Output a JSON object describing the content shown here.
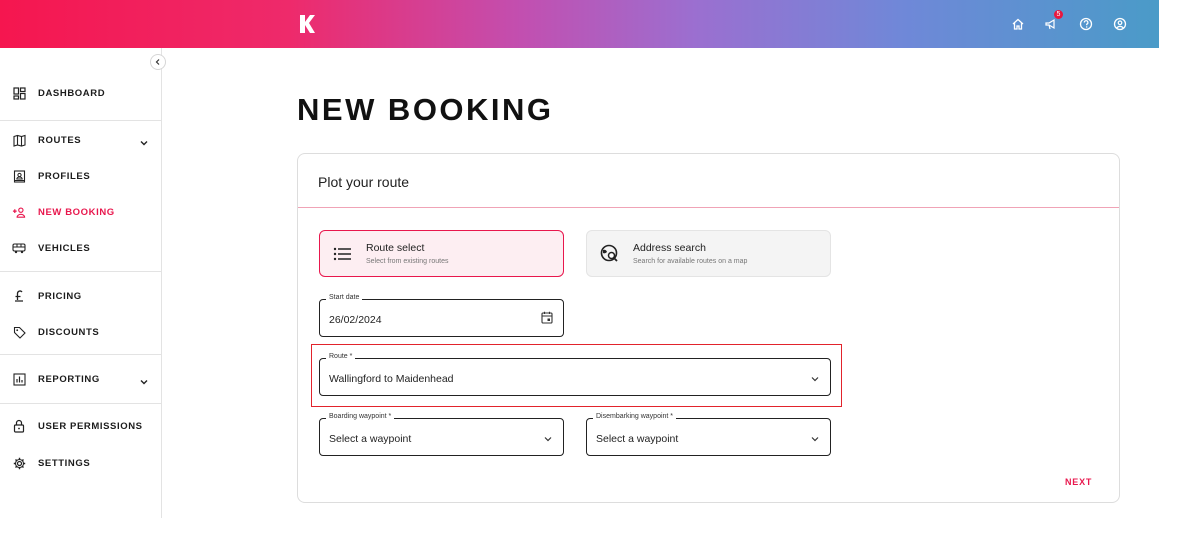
{
  "header": {
    "logo_letter": "K",
    "notification_count": "5",
    "icons": [
      "home-icon",
      "megaphone-icon",
      "help-icon",
      "account-icon"
    ]
  },
  "sidebar": {
    "items": [
      {
        "label": "DASHBOARD",
        "icon": "dashboard-icon"
      },
      {
        "label": "ROUTES",
        "icon": "map-icon"
      },
      {
        "label": "PROFILES",
        "icon": "profile-card-icon"
      },
      {
        "label": "NEW BOOKING",
        "icon": "add-person-icon"
      },
      {
        "label": "VEHICLES",
        "icon": "bus-icon"
      },
      {
        "label": "PRICING",
        "icon": "pound-icon"
      },
      {
        "label": "DISCOUNTS",
        "icon": "tag-icon"
      },
      {
        "label": "REPORTING",
        "icon": "chart-icon"
      },
      {
        "label": "USER PERMISSIONS",
        "icon": "lock-icon"
      },
      {
        "label": "SETTINGS",
        "icon": "gear-icon"
      }
    ],
    "active": "NEW BOOKING"
  },
  "main": {
    "title": "NEW BOOKING",
    "card_title": "Plot your route",
    "options": [
      {
        "title": "Route select",
        "subtitle": "Select from existing routes",
        "selected": true
      },
      {
        "title": "Address search",
        "subtitle": "Search for available routes on a map",
        "selected": false
      }
    ],
    "start_date": {
      "label": "Start date",
      "value": "26/02/2024"
    },
    "route": {
      "label": "Route *",
      "value": "Wallingford to Maidenhead"
    },
    "boarding": {
      "label": "Boarding waypoint *",
      "value": "Select a waypoint"
    },
    "disembarking": {
      "label": "Disembarking waypoint *",
      "value": "Select a waypoint"
    },
    "next_label": "NEXT"
  },
  "colors": {
    "accent": "#e8174d",
    "highlight": "#e2232c"
  }
}
